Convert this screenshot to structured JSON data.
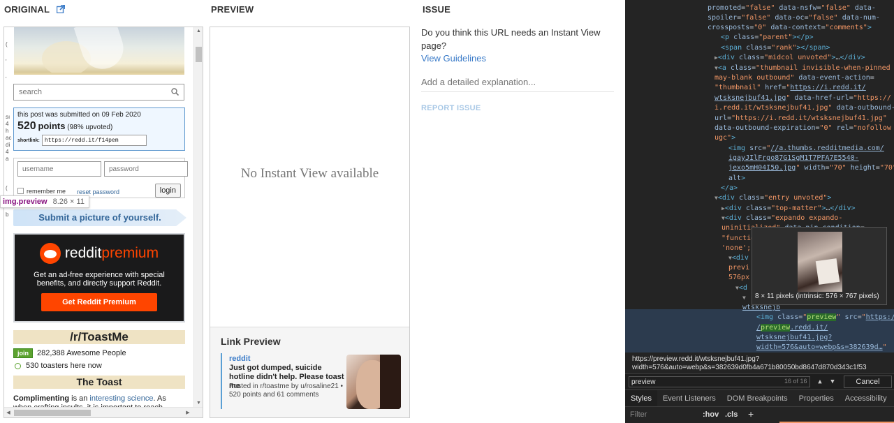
{
  "headers": {
    "original": "ORIGINAL",
    "preview": "PREVIEW",
    "issue": "ISSUE"
  },
  "original": {
    "search_placeholder": "search",
    "post_info": {
      "submitted": "this post was submitted on 09 Feb 2020",
      "points": "520",
      "points_label": "points",
      "upvoted": "(98% upvoted)",
      "shortlink_label": "shortlink:",
      "shortlink": "https://redd.it/f14pem"
    },
    "login": {
      "username_placeholder": "username",
      "password_placeholder": "password",
      "remember": "remember me",
      "reset": "reset password",
      "login_button": "login"
    },
    "element_tag": {
      "name": "img.preview",
      "size": "8.26 × 11"
    },
    "submit_picture": "Submit a picture of yourself.",
    "premium": {
      "brand": "reddit",
      "brand_accent": "premium",
      "description": "Get an ad-free experience with special benefits, and directly support Reddit.",
      "button": "Get Reddit Premium"
    },
    "subreddit": {
      "name": "/r/ToastMe",
      "join": "join",
      "subscribers": "282,388 Awesome People",
      "online": "530 toasters here now",
      "section_title": "The Toast",
      "body_bold": "Complimenting",
      "body_pre": " is an ",
      "body_link": "interesting science",
      "body_post": ". As when crafting insults, it is important to reach"
    },
    "edge_chars": [
      "(",
      "'",
      "'",
      "'",
      "'",
      "'",
      "'",
      "(",
      "sı",
      "4",
      "h",
      "ac",
      "di",
      "4",
      "a",
      "(",
      "b"
    ]
  },
  "preview": {
    "no_iv": "No Instant View available",
    "link_preview_heading": "Link Preview",
    "site": "reddit",
    "title": "Just got dumped, suicide hotline didn't help. Please toast me",
    "description": "Posted in r/toastme by u/rosaline21 • 520 points and 61 comments"
  },
  "issue": {
    "question": "Do you think this URL needs an Instant View page?",
    "guidelines": "View Guidelines",
    "placeholder": "Add a detailed explanation...",
    "report": "REPORT ISSUE"
  },
  "devtools": {
    "image_tooltip": "8 × 11 pixels (intrinsic: 576 × 767 pixels)",
    "url_line1": "https://preview.redd.it/wtsksnejbuf41.jpg?",
    "url_line2": "width=576&auto=webp&s=382639d0fb4a671b80050bd8647d870d343c1f53",
    "find_value": "preview",
    "find_count": "16 of 16",
    "cancel": "Cancel",
    "tabs": [
      "Styles",
      "Event Listeners",
      "DOM Breakpoints",
      "Properties",
      "Accessibility"
    ],
    "filter_placeholder": "Filter",
    "hov": ":hov",
    "cls": ".cls",
    "plus": "+"
  },
  "colors": {
    "link_blue": "#3a7bc8",
    "reddit_orange": "#ff4500",
    "devtools_bg": "#242424",
    "search_highlight": "#2a6b2a"
  }
}
